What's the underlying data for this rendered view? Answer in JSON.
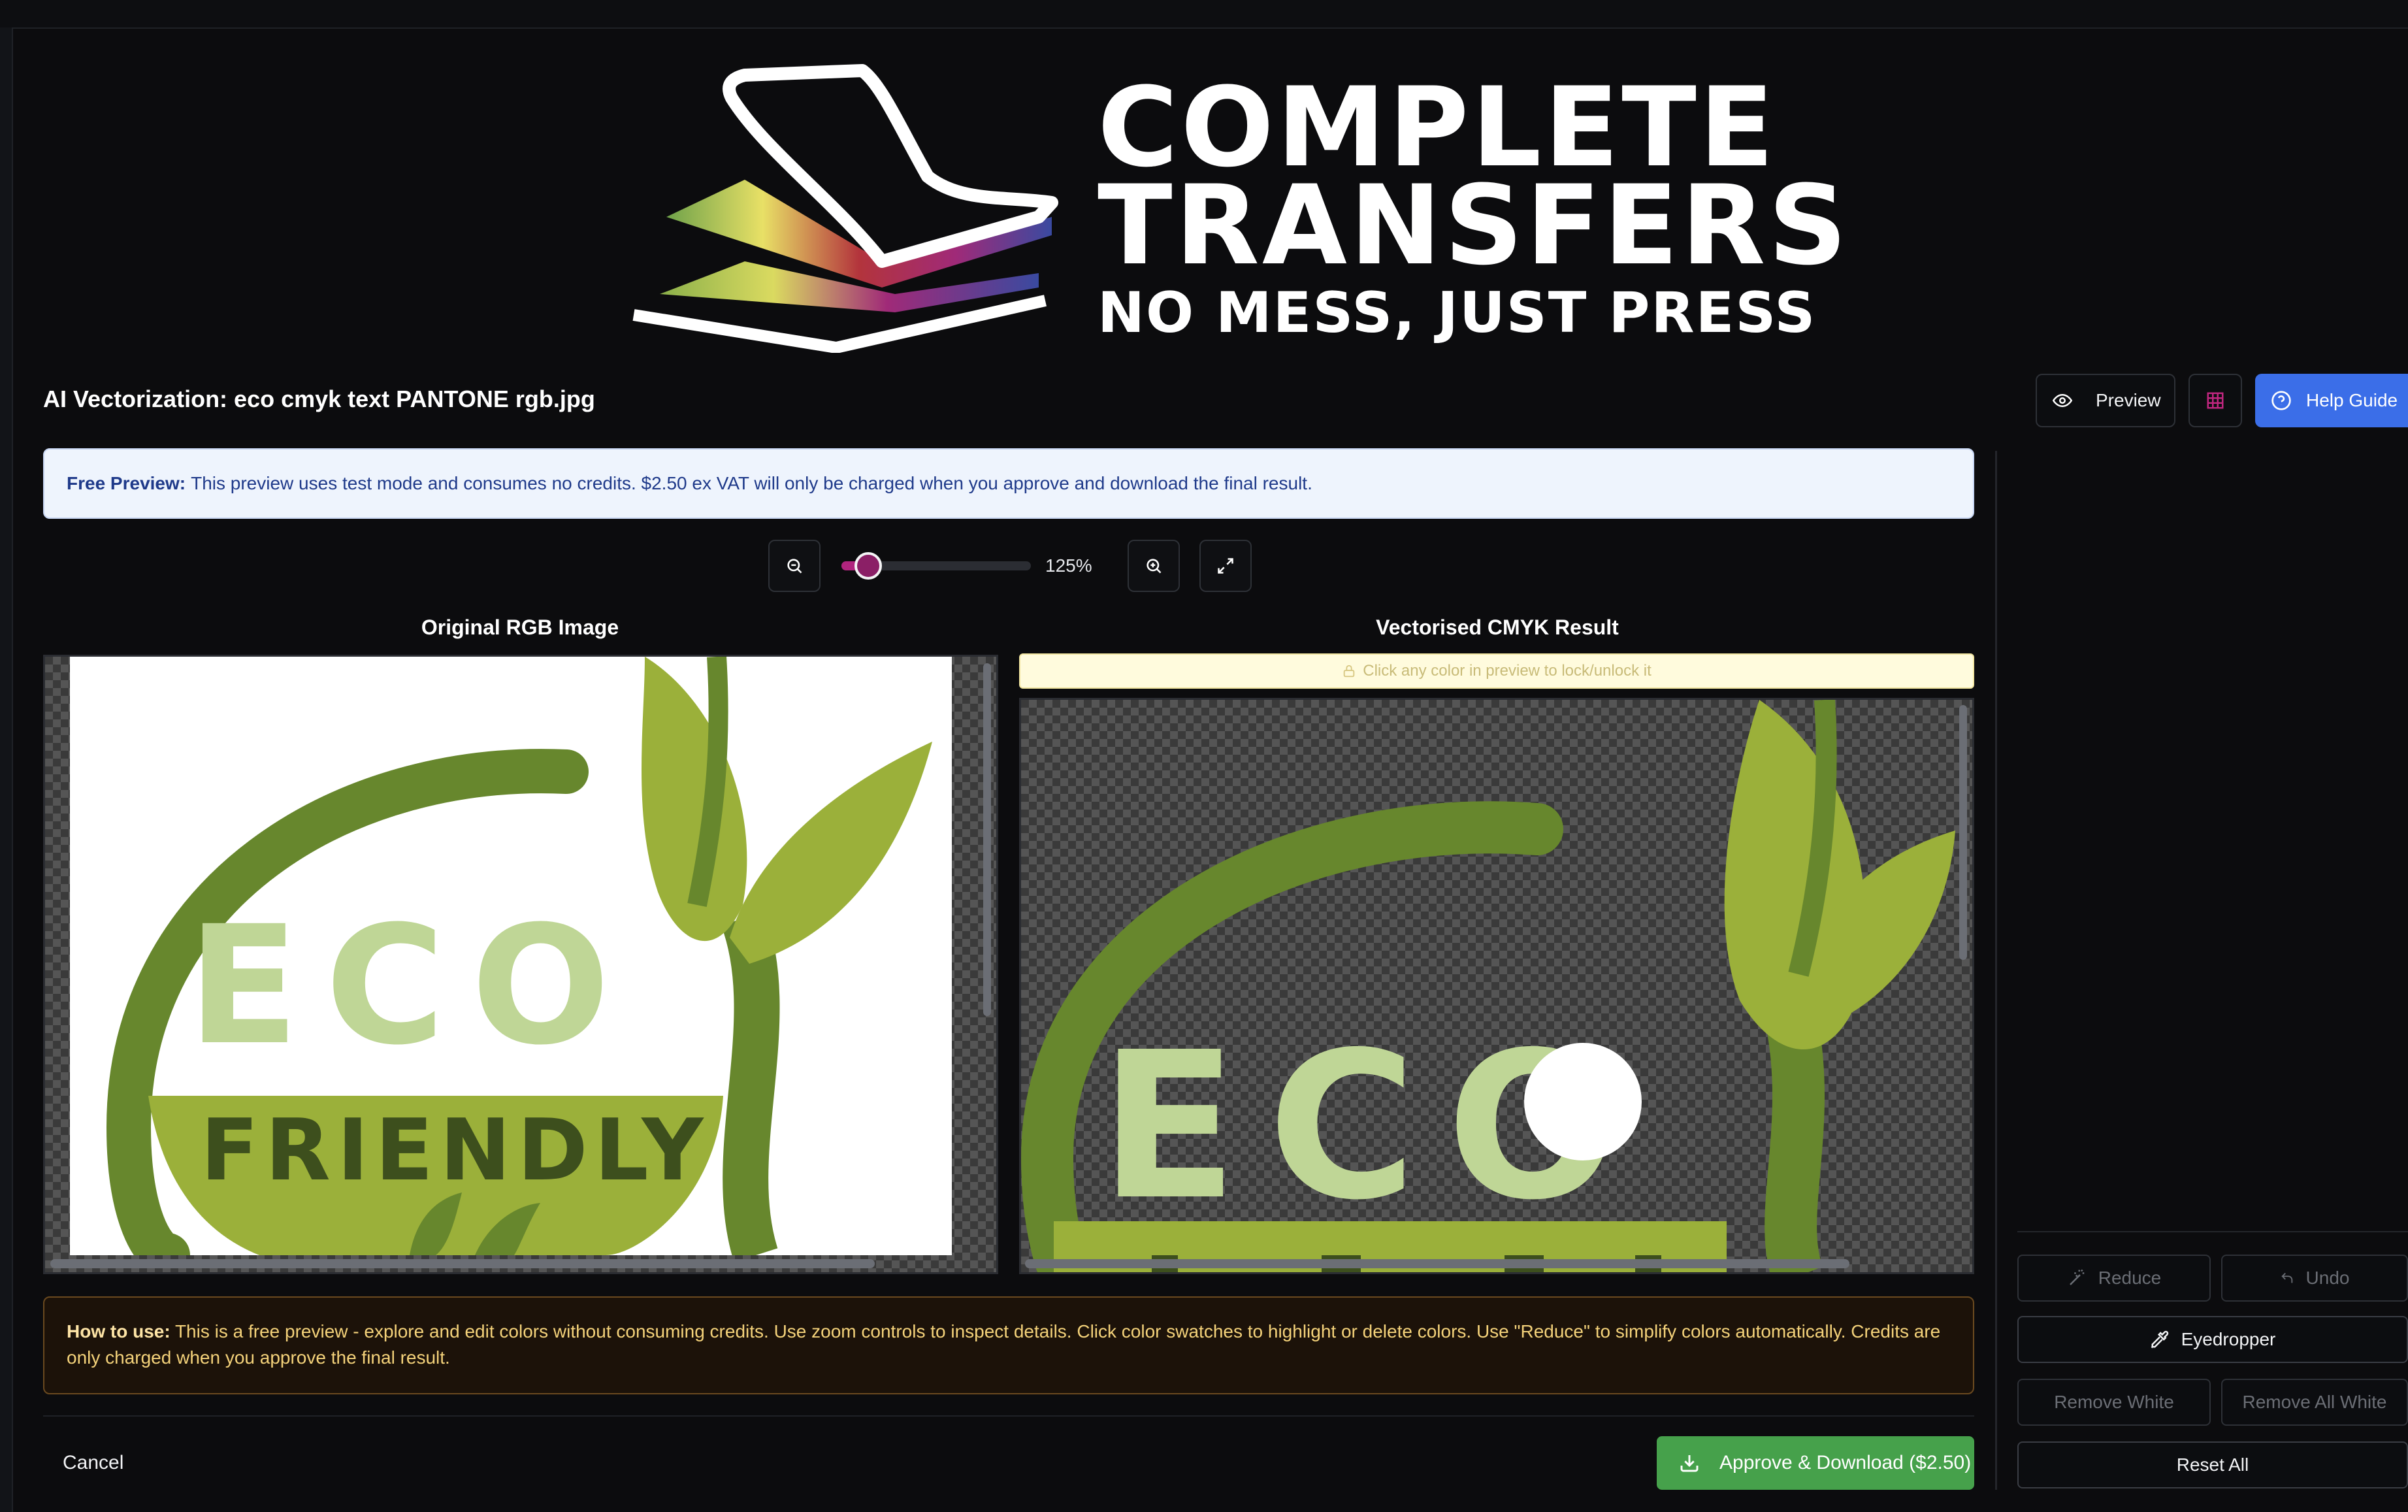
{
  "logo": {
    "line1": "COMPLETE",
    "line2": "TRANSFERS",
    "tagline": "NO MESS, JUST PRESS"
  },
  "header": {
    "title": "AI Vectorization: eco cmyk text PANTONE rgb.jpg",
    "preview_label": "Preview",
    "help_label": "Help Guide"
  },
  "notice": {
    "bold": "Free Preview:",
    "text": "This preview uses test mode and consumes no credits. $2.50 ex VAT will only be charged when you approve and download the final result."
  },
  "zoom": {
    "level_label": "125%",
    "level_fraction": 0.08
  },
  "panels": {
    "left_title": "Original RGB Image",
    "right_title": "Vectorised CMYK Result",
    "lock_hint": "Click any color in preview to lock/unlock it"
  },
  "artwork": {
    "eco_text": "ECO",
    "friendly_text": "FRIENDLY",
    "colors": {
      "dark_green": "#67872d",
      "mid_green": "#9bb03a",
      "light_green": "#bfd696",
      "leaf_dark": "#5f7f29"
    }
  },
  "howto": {
    "bold": "How to use:",
    "text": "This is a free preview - explore and edit colors without consuming credits. Use zoom controls to inspect details. Click color swatches to highlight or delete colors. Use \"Reduce\" to simplify colors automatically. Credits are only charged when you approve the final result."
  },
  "footer": {
    "cancel_label": "Cancel",
    "approve_label": "Approve & Download ($2.50)"
  },
  "tools": {
    "reduce": "Reduce",
    "undo": "Undo",
    "eyedropper": "Eyedropper",
    "remove_white": "Remove White",
    "remove_all_white": "Remove All White",
    "reset_all": "Reset All"
  },
  "colors": {
    "accent_blue": "#3b6ee8",
    "approve_green": "#46a14b",
    "slider_magenta": "#b0247e"
  }
}
